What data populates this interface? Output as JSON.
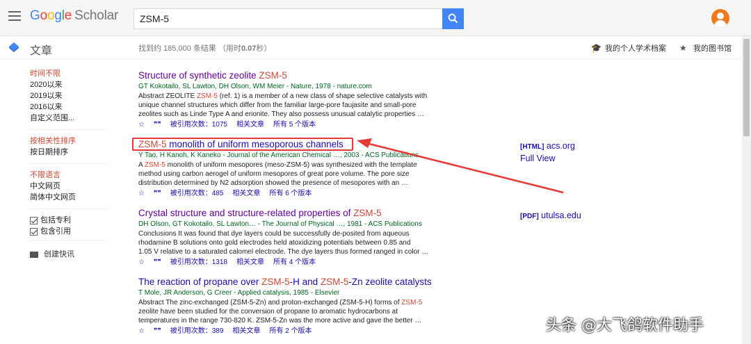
{
  "header": {
    "logo_google": [
      "G",
      "o",
      "o",
      "g",
      "l",
      "e"
    ],
    "logo_scholar": "Scholar",
    "search_value": "ZSM-5"
  },
  "subbar": {
    "section": "文章",
    "result_count": "找到约 185,000 条结果",
    "result_time_prefix": "（用时",
    "result_time": "0.07",
    "result_time_suffix": "秒）",
    "my_profile": "我的个人学术档案",
    "my_library": "我的图书馆"
  },
  "sidebar": {
    "time": [
      "时间不限",
      "2020以来",
      "2019以来",
      "2016以来",
      "自定义范围..."
    ],
    "sort": [
      "按相关性排序",
      "按日期排序"
    ],
    "lang": [
      "不限语言",
      "中文网页",
      "简体中文网页"
    ],
    "include_patents": "包括专利",
    "include_citations": "包含引用",
    "create_alert": "创建快讯"
  },
  "results": [
    {
      "title_a": "Structure of synthetic zeolite ",
      "title_hl": "ZSM-5",
      "title_b": "",
      "authors": "GT Kokotailo, SL Lawton, DH Olson, WM Meier - Nature, 1978 - nature.com",
      "snip1_a": "Abstract ZEOLITE ",
      "snip1_hl": "ZSM-5",
      "snip1_b": " (ref. 1) is a member of a new class of shape selective catalysts with",
      "snip2": "unique channel structures which differ from the familiar large-pore faujasite and small-pore",
      "snip3": "zeolites such as Linde Type A and erionite. They also possess unusual catalytic properties …",
      "cite": "被引用次数：1075",
      "related": "相关文章",
      "versions": "所有 5 个版本"
    },
    {
      "title_a": "",
      "title_hl": "ZSM-5",
      "title_b": " monolith of uniform mesoporous channels",
      "authors": "Y Tao, H Kanoh, K Kaneko - Journal of the American Chemical …, 2003 - ACS Publications",
      "snip1_a": "A ",
      "snip1_hl": "ZSM-5",
      "snip1_b": " monolith of uniform mesopores (meso-ZSM-5) was synthesized with the template",
      "snip2": "method using carbon aerogel of uniform mesopores of great pore volume. The pore size",
      "snip3": "distribution determined by N2 adsorption showed the presence of mesopores with an …",
      "cite": "被引用次数：485",
      "related": "相关文章",
      "versions": "所有 6 个版本"
    },
    {
      "title_a": "Crystal structure and structure-related properties of ",
      "title_hl": "ZSM-5",
      "title_b": "",
      "authors": "DH Olson, GT Kokotailo, SL Lawton… - The Journal of Physical …, 1981 - ACS Publications",
      "snip1_a": "Conclusions It was found that dye layers could be successfully de-posited from aqueous",
      "snip1_hl": "",
      "snip1_b": "",
      "snip2": "rhodamine B solutions onto gold electrodes held atoxidizing potentials between 0.85 and",
      "snip3": "1.05 V relative to a saturated calomel electrode. The dye layers thus formed ranged in color …",
      "cite": "被引用次数：1318",
      "related": "相关文章",
      "versions": "所有 4 个版本"
    },
    {
      "title_a": "The reaction of propane over ",
      "title_hl": "ZSM-5",
      "title_b": "-H and ",
      "title_hl2": "ZSM-5",
      "title_c": "-Zn zeolite catalysts",
      "authors": "T Mole, JR Anderson, G Creer - Applied catalysis, 1985 - Elsevier",
      "snip1_a": "Abstract The zinc-exchanged (ZSM-5-Zn) and proton-exchanged (ZSM-5-H) forms of ",
      "snip1_hl": "ZSM-5",
      "snip1_b": "",
      "snip2": "zeolite have been studied for the conversion of propane to aromatic hydrocarbons at",
      "snip3": "temperatures in the range 730-820 K. ZSM-5-Zn was the more active and gave the better …",
      "cite": "被引用次数：389",
      "related": "相关文章",
      "versions": "所有 2 个版本"
    }
  ],
  "right_links": [
    {
      "tag": "[HTML]",
      "domain": "acs.org",
      "extra": "Full View"
    },
    {
      "tag": "[PDF]",
      "domain": "utulsa.edu"
    }
  ],
  "watermark": "头条 @大飞鸽软件助手",
  "colors": {
    "accent": "#4285f4",
    "highlight": "#d14836",
    "visited": "#660099",
    "author_green": "#006621",
    "annotation_red": "#e53935"
  }
}
